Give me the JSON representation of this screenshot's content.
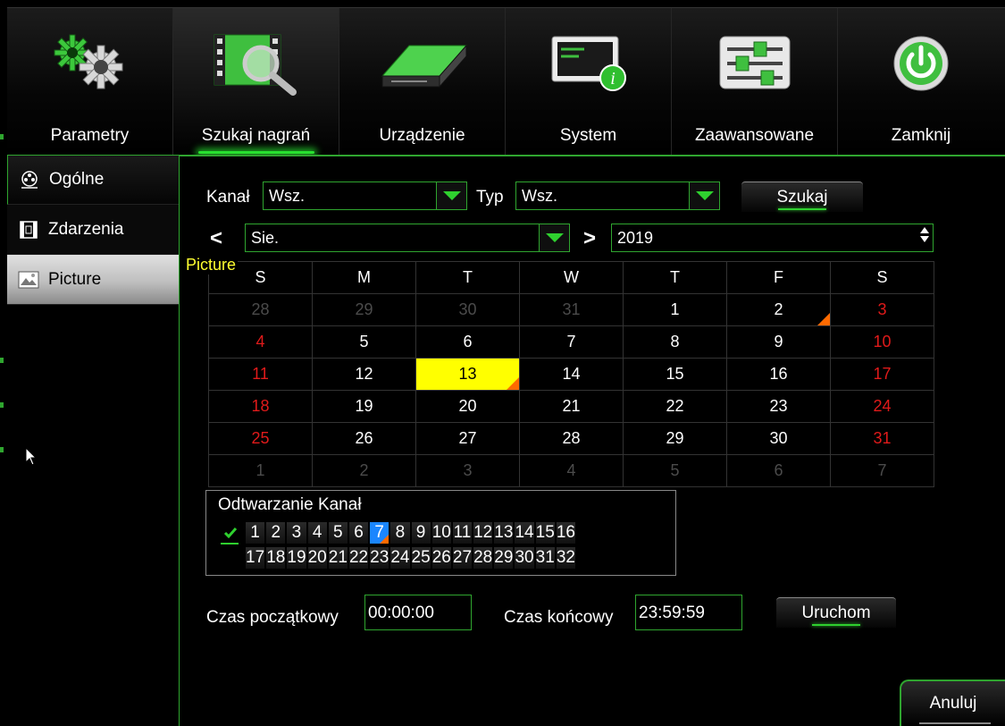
{
  "nav": {
    "items": [
      {
        "label": "Parametry",
        "icon": "gears-icon"
      },
      {
        "label": "Szukaj nagrań",
        "icon": "film-search-icon"
      },
      {
        "label": "Urządzenie",
        "icon": "hard-drive-icon"
      },
      {
        "label": "System",
        "icon": "monitor-info-icon"
      },
      {
        "label": "Zaawansowane",
        "icon": "sliders-icon"
      },
      {
        "label": "Zamknij",
        "icon": "power-icon"
      }
    ],
    "active": "Szukaj nagrań"
  },
  "sidebar": {
    "items": [
      {
        "label": "Ogólne",
        "icon": "film-reel-icon"
      },
      {
        "label": "Zdarzenia",
        "icon": "event-film-icon"
      },
      {
        "label": "Picture",
        "icon": "picture-icon"
      }
    ],
    "selected": "Picture",
    "tooltip": "Picture"
  },
  "search": {
    "channel_label": "Kanał",
    "channel_value": "Wsz.",
    "type_label": "Typ",
    "type_value": "Wsz.",
    "search_button": "Szukaj",
    "month_value": "Sie.",
    "prev_symbol": "<",
    "next_symbol": ">",
    "year_value": "2019"
  },
  "calendar": {
    "weekdays": [
      "S",
      "M",
      "T",
      "W",
      "T",
      "F",
      "S"
    ],
    "weeks": [
      [
        "28",
        "29",
        "30",
        "31",
        "1",
        "2",
        "3"
      ],
      [
        "4",
        "5",
        "6",
        "7",
        "8",
        "9",
        "10"
      ],
      [
        "11",
        "12",
        "13",
        "14",
        "15",
        "16",
        "17"
      ],
      [
        "18",
        "19",
        "20",
        "21",
        "22",
        "23",
        "24"
      ],
      [
        "25",
        "26",
        "27",
        "28",
        "29",
        "30",
        "31"
      ],
      [
        "1",
        "2",
        "3",
        "4",
        "5",
        "6",
        "7"
      ]
    ],
    "selected_day": "13",
    "marked_days": [
      "2",
      "13"
    ]
  },
  "playback": {
    "title": "Odtwarzanie Kanał",
    "row1": [
      "1",
      "2",
      "3",
      "4",
      "5",
      "6",
      "7",
      "8",
      "9",
      "10",
      "11",
      "12",
      "13",
      "14",
      "15",
      "16"
    ],
    "row2": [
      "17",
      "18",
      "19",
      "20",
      "21",
      "22",
      "23",
      "24",
      "25",
      "26",
      "27",
      "28",
      "29",
      "30",
      "31",
      "32"
    ],
    "selected_channel": "7",
    "start_label": "Czas początkowy",
    "start_value": "00:00:00",
    "end_label": "Czas końcowy",
    "end_value": "23:59:59",
    "run_button": "Uruchom"
  },
  "cancel_button": "Anuluj",
  "colors": {
    "accent": "#2fa52f",
    "selected_day": "#ffff00",
    "weekend": "#e01a1a",
    "event_marker": "#ff6a00",
    "channel_selected": "#1a86ff"
  }
}
